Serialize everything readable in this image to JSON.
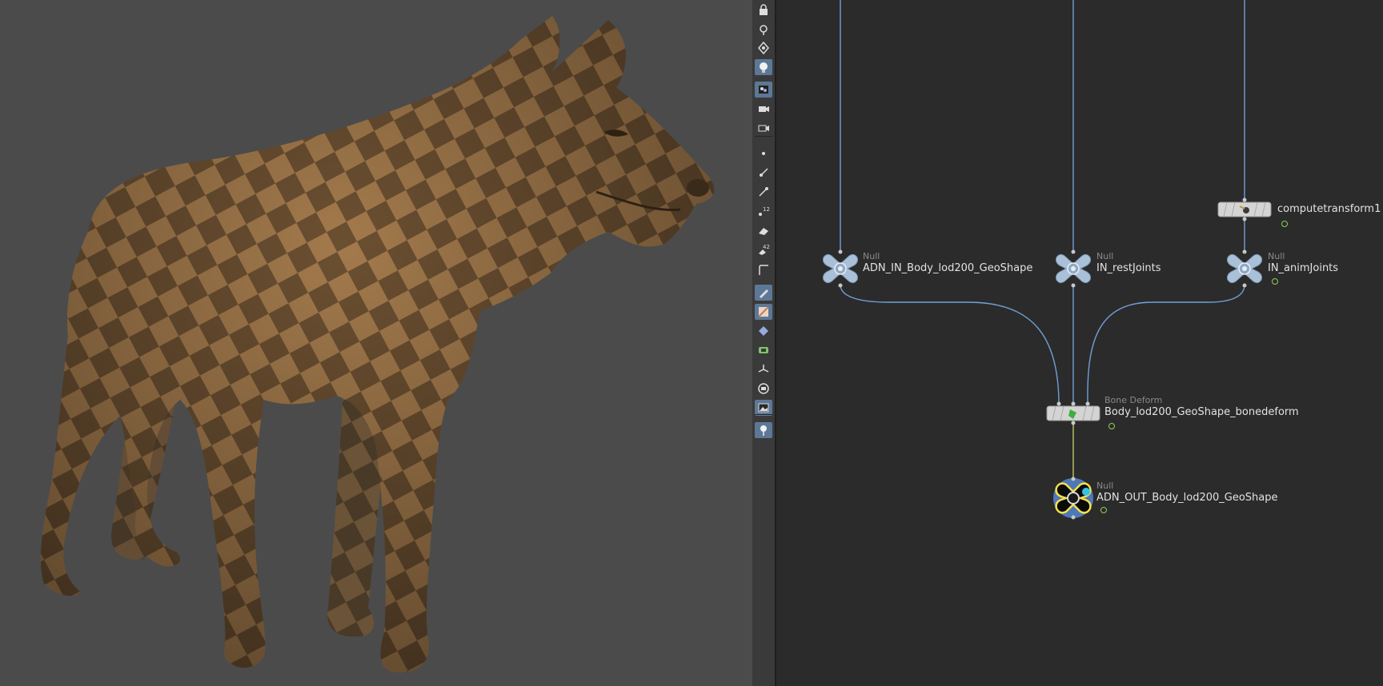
{
  "viewport": {
    "background_color": "#4b4b4b",
    "model": "wolf-checker-uv-mesh",
    "checker_colors": [
      "#a37a4c",
      "#6b4f31"
    ]
  },
  "toolbar": {
    "buttons": [
      {
        "name": "lock-icon",
        "active": false
      },
      {
        "name": "snap-icon",
        "active": false
      },
      {
        "name": "pin-icon",
        "active": false
      },
      {
        "name": "light-icon",
        "active": true
      },
      {
        "name": "display-options-icon",
        "active": true
      },
      {
        "name": "camera-icon",
        "active": false
      },
      {
        "name": "camera-view-icon",
        "active": false
      },
      {
        "name": "point-display-icon",
        "active": false
      },
      {
        "name": "normal-display-icon",
        "active": false
      },
      {
        "name": "vector-display-icon",
        "active": false
      },
      {
        "name": "number-display-icon",
        "active": false,
        "label": "12"
      },
      {
        "name": "primitive-icon",
        "active": false
      },
      {
        "name": "primitive-number-icon",
        "active": false,
        "label": "42"
      },
      {
        "name": "edge-icon",
        "active": false
      },
      {
        "name": "brush-icon",
        "active": true
      },
      {
        "name": "texture-icon",
        "active": true
      },
      {
        "name": "shaded-icon",
        "active": false
      },
      {
        "name": "template-icon",
        "active": false
      },
      {
        "name": "pivot-icon",
        "active": false
      },
      {
        "name": "grid-icon",
        "active": false
      },
      {
        "name": "background-image-icon",
        "active": true
      },
      {
        "name": "viewport-pin-icon",
        "active": true
      }
    ]
  },
  "network": {
    "wire_color": "#6f9fd8",
    "selected_wire_color": "#d7e26a",
    "nodes": [
      {
        "id": "computetransform",
        "type_label": "",
        "label": "computetransform1"
      },
      {
        "id": "adn_in",
        "type_label": "Null",
        "label": "ADN_IN_Body_lod200_GeoShape"
      },
      {
        "id": "in_rest",
        "type_label": "Null",
        "label": "IN_restJoints"
      },
      {
        "id": "in_anim",
        "type_label": "Null",
        "label": "IN_animJoints"
      },
      {
        "id": "bonedeform",
        "type_label": "Bone Deform",
        "label": "Body_lod200_GeoShape_bonedeform"
      },
      {
        "id": "adn_out",
        "type_label": "Null",
        "label": "ADN_OUT_Body_lod200_GeoShape"
      }
    ]
  }
}
